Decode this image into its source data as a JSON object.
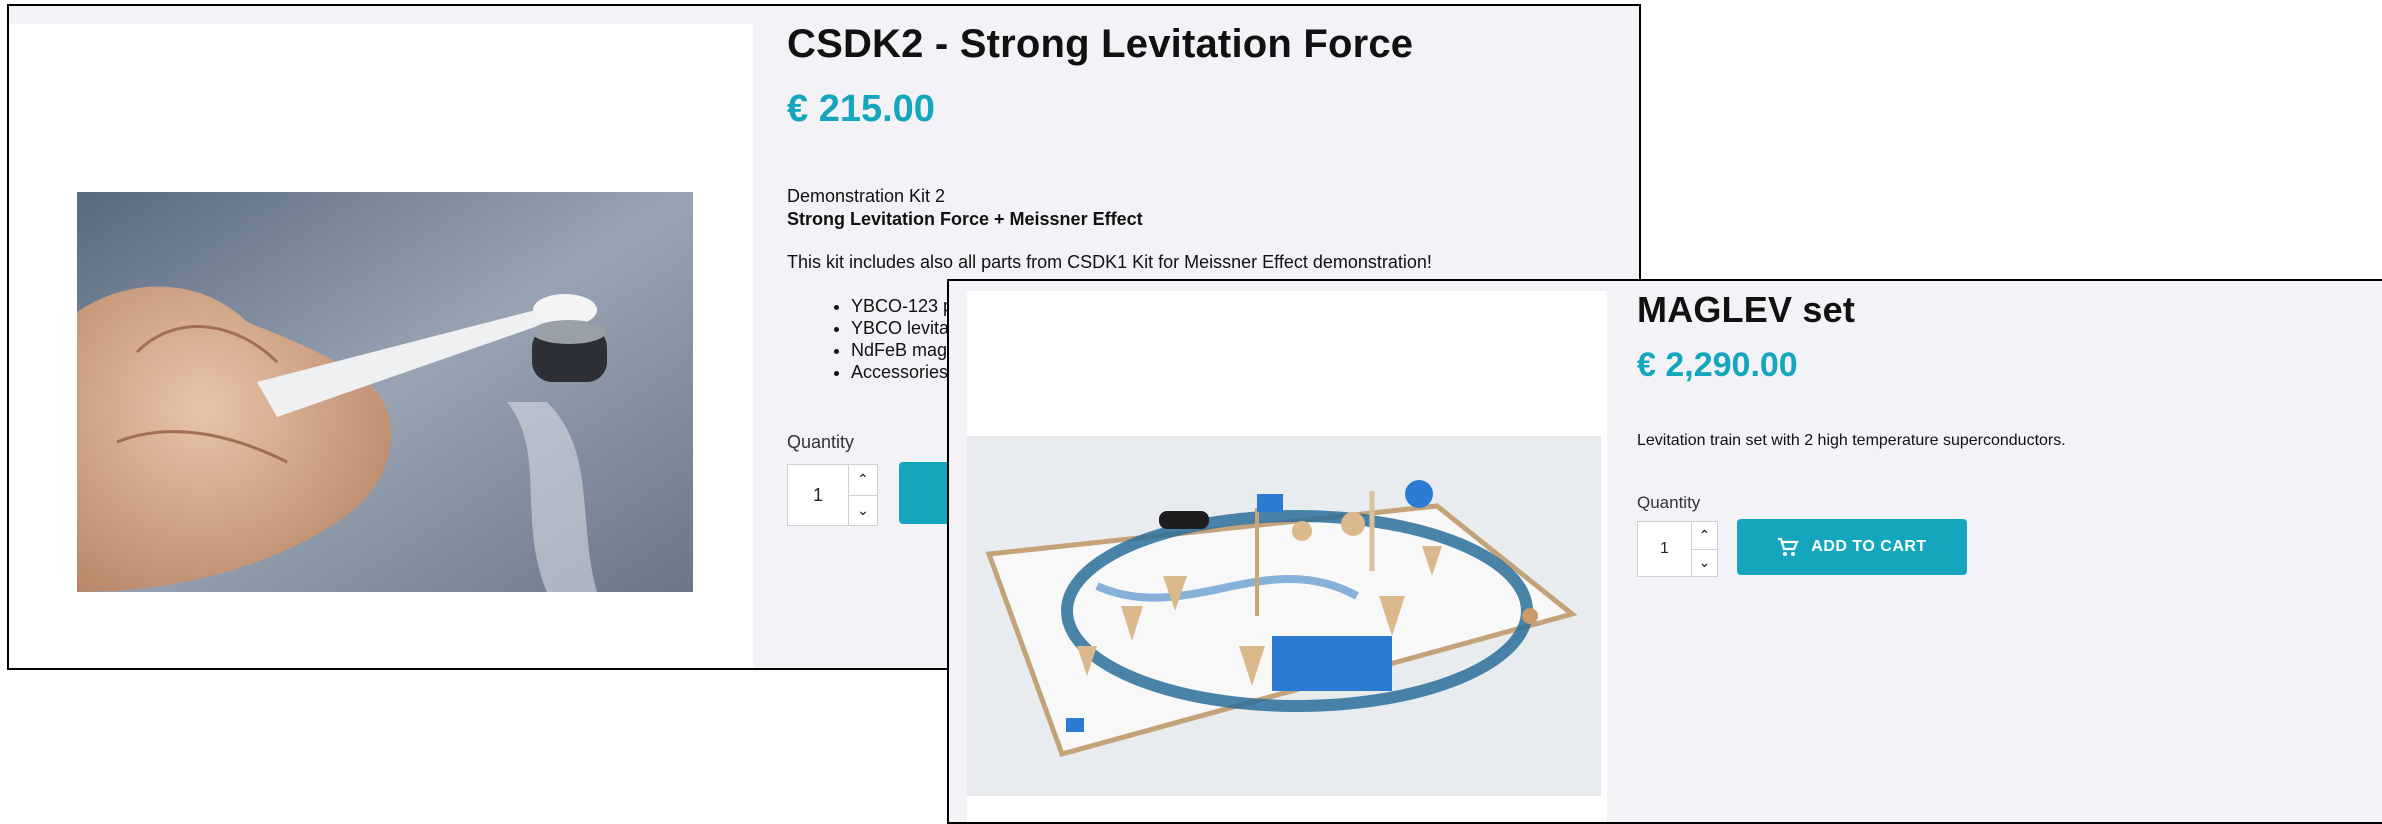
{
  "product1": {
    "title": "CSDK2 - Strong Levitation Force",
    "price": "€ 215.00",
    "subtitle": "Demonstration Kit 2",
    "subtitle_bold": "Strong Levitation Force + Meissner Effect",
    "description": "This kit includes also all parts from CSDK1 Kit for Meissner Effect demonstration!",
    "features": [
      "YBCO-123 p",
      "YBCO levita",
      "NdFeB mag",
      "Accessories"
    ],
    "quantity_label": "Quantity",
    "quantity_value": "1",
    "image_icon": "tweezers-magnet-photo"
  },
  "product2": {
    "title": "MAGLEV set",
    "price": "€ 2,290.00",
    "description": "Levitation train set with 2 high temperature superconductors.",
    "quantity_label": "Quantity",
    "quantity_value": "1",
    "add_to_cart_label": "ADD TO CART",
    "cart_icon": "cart-icon",
    "image_icon": "maglev-track-photo"
  },
  "colors": {
    "accent": "#13a6bd",
    "panel_bg": "#f2f2f7",
    "image_bg": "#ffffff"
  }
}
